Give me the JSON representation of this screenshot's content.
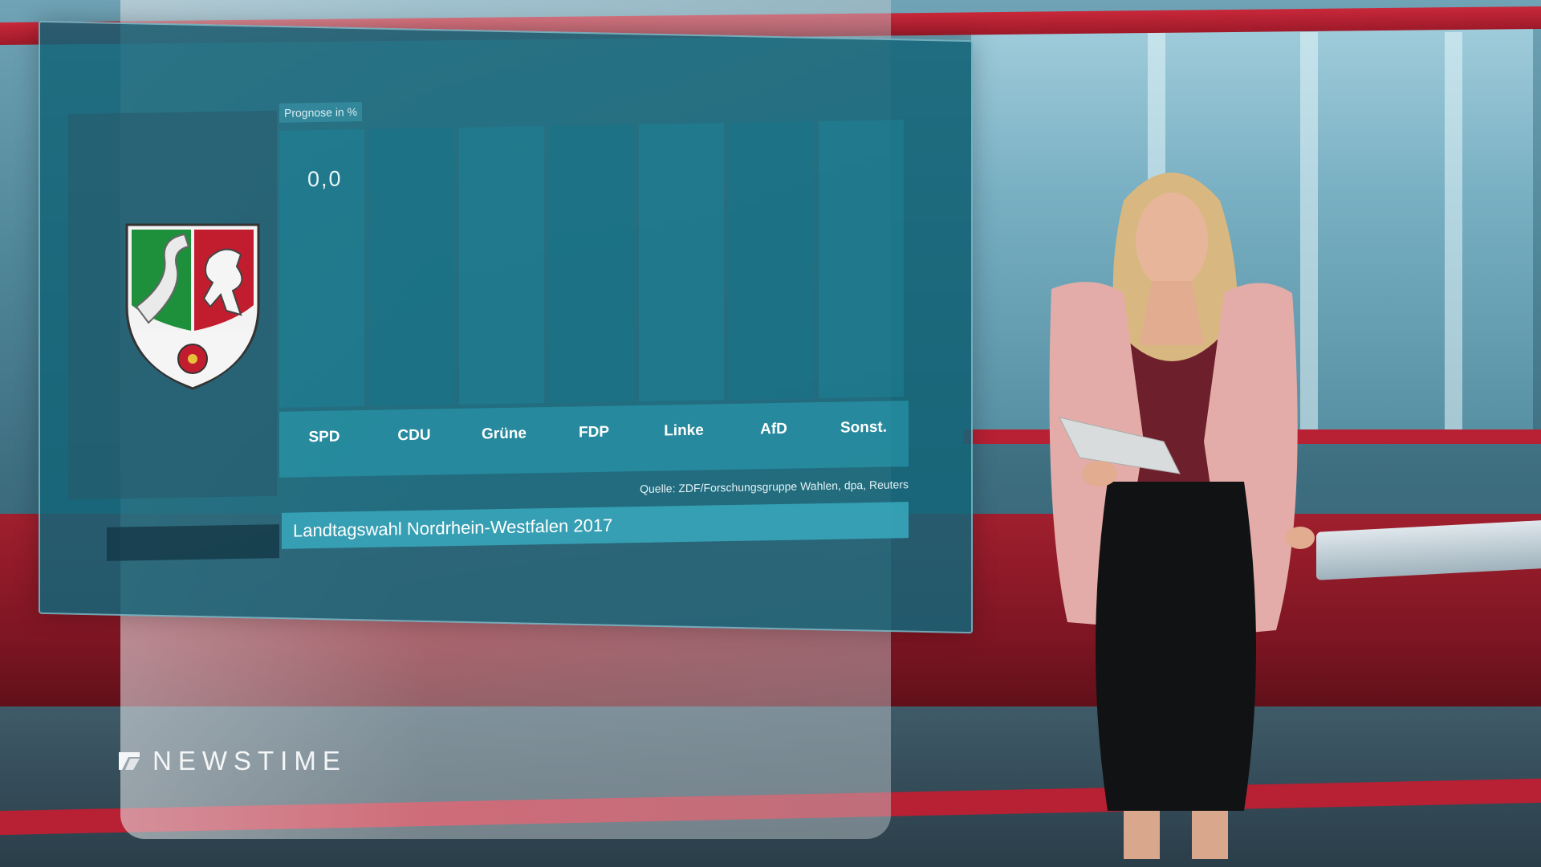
{
  "chart_data": {
    "type": "bar",
    "title": "Prognose in %",
    "categories": [
      "SPD",
      "CDU",
      "Grüne",
      "FDP",
      "Linke",
      "AfD",
      "Sonst."
    ],
    "values": [
      0,
      0,
      0,
      0,
      0,
      0,
      0
    ],
    "value_display": "0,0",
    "source": "Quelle: ZDF/Forschungsgruppe Wahlen, dpa, Reuters",
    "headline": "Landtagswahl Nordrhein-Westfalen 2017"
  },
  "logo": {
    "text": "NEWSTIME"
  },
  "colors": {
    "panel": "#14647a",
    "studio_red": "#b82033",
    "title_bar": "#37a5b9"
  }
}
